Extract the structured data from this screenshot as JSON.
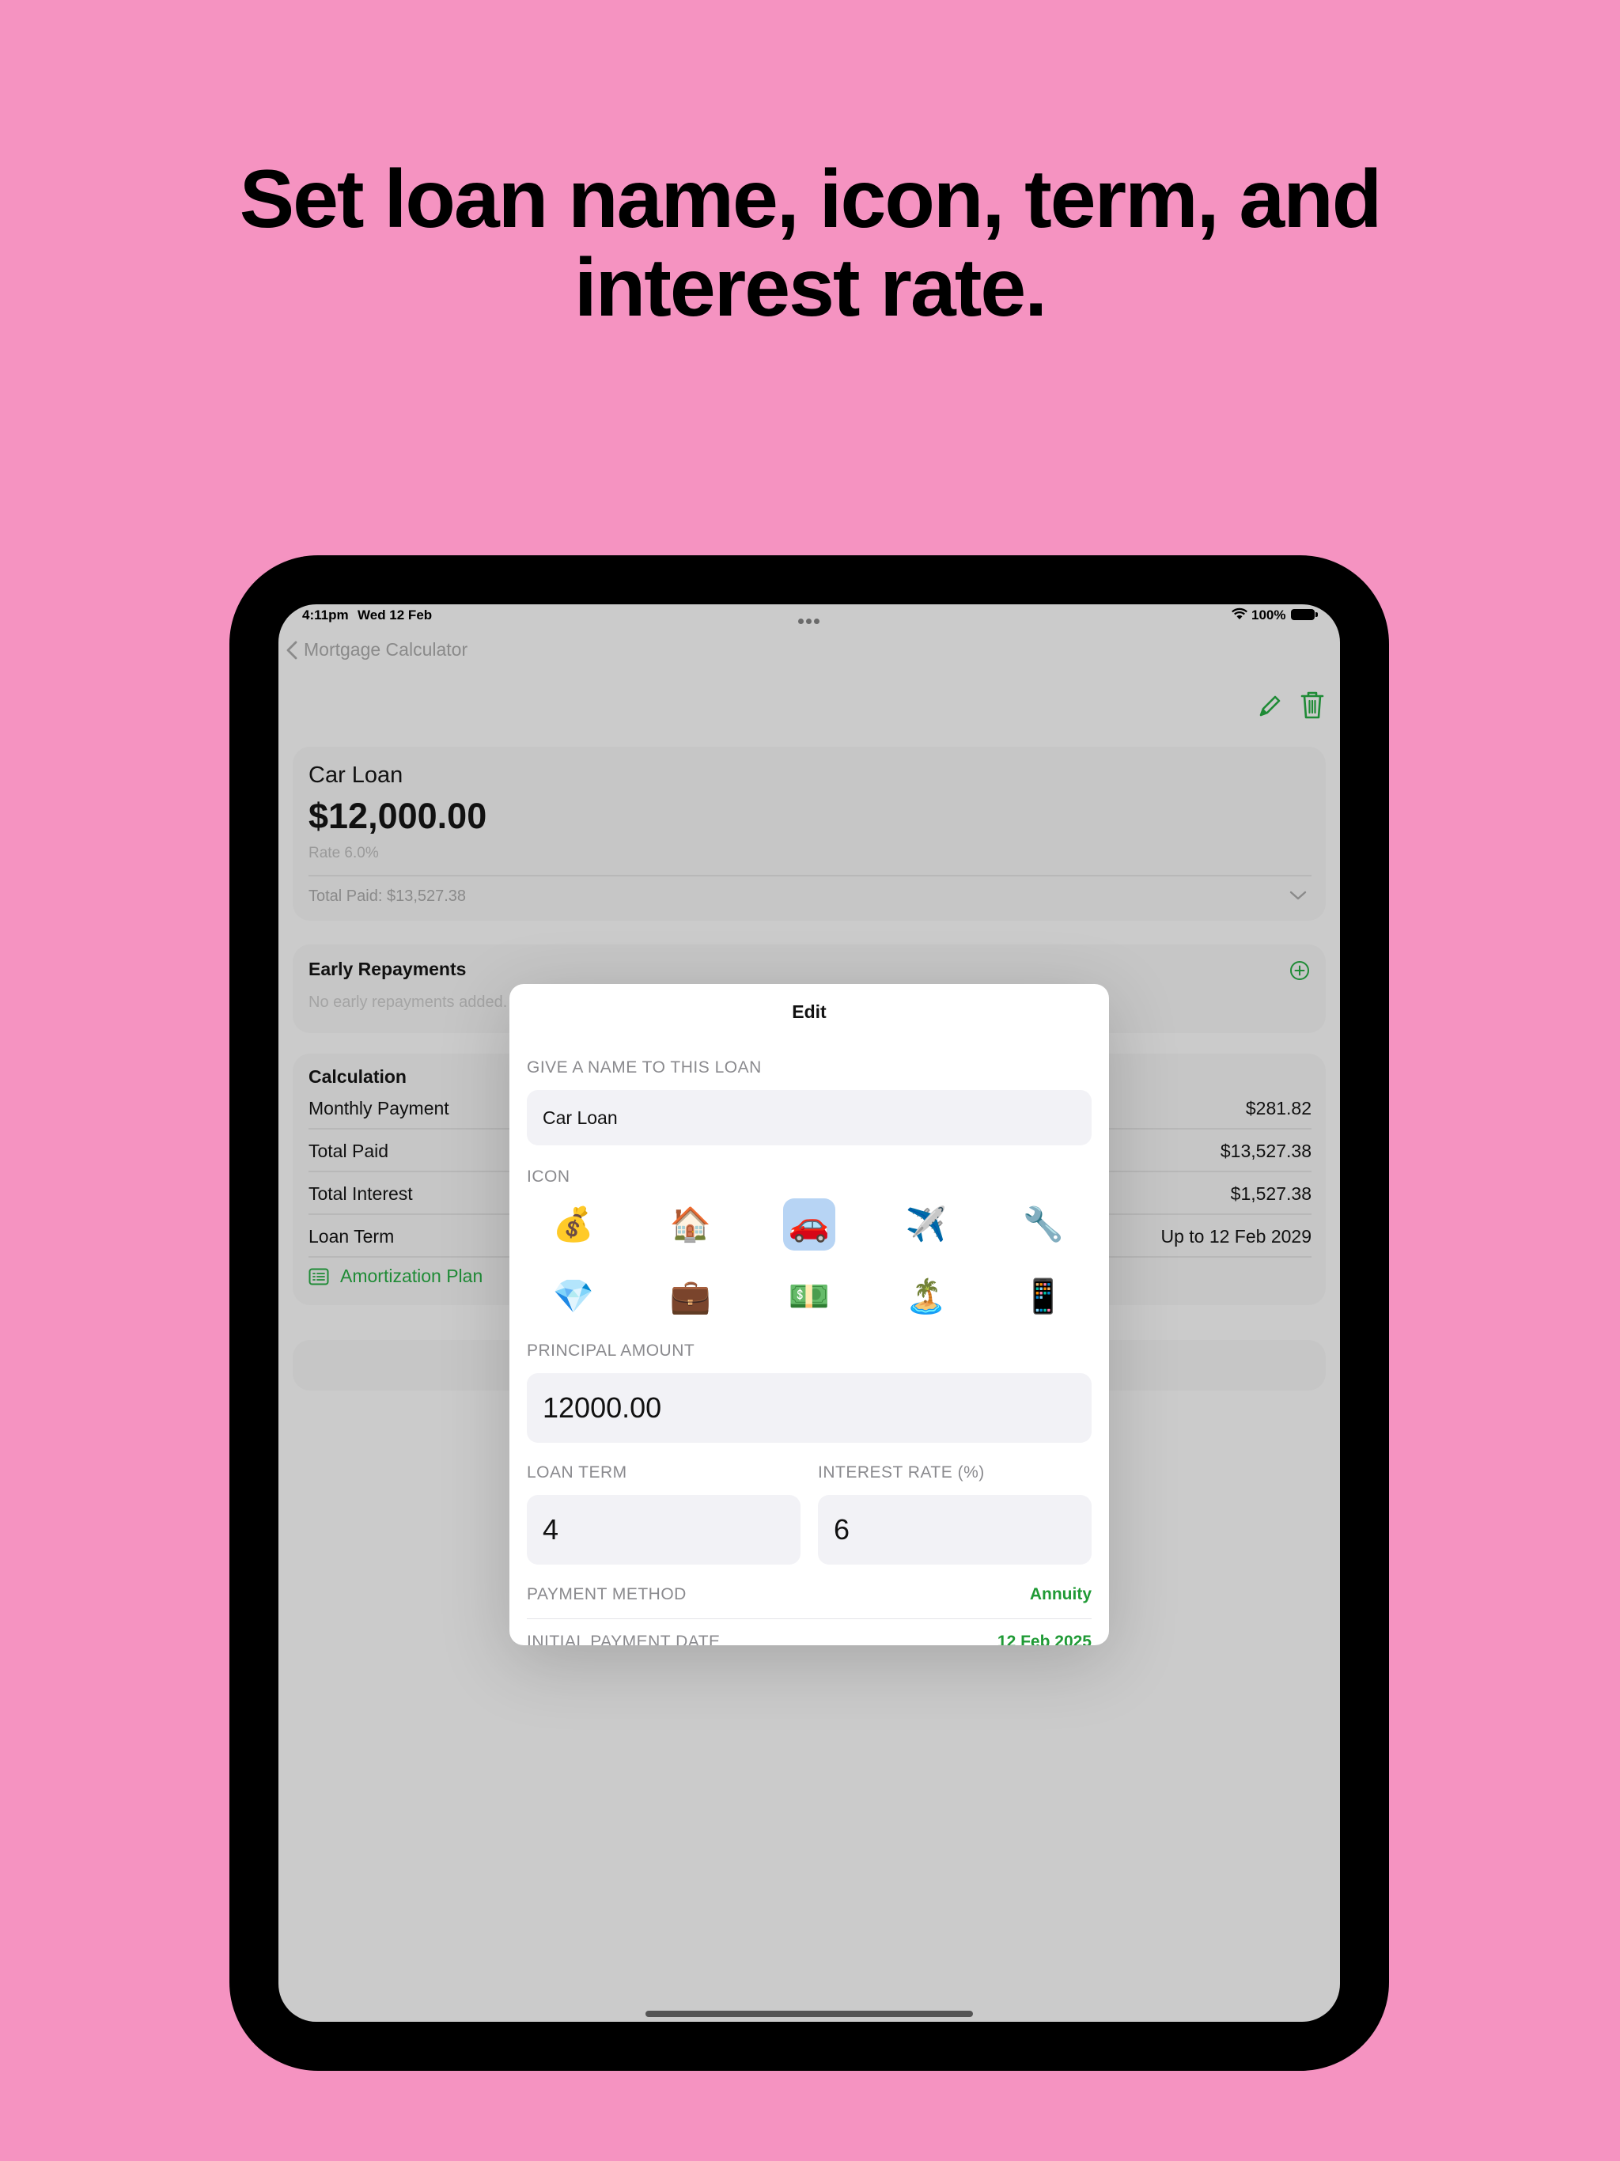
{
  "headline": {
    "line1": "Set loan name, icon, term, and",
    "line2": "interest rate."
  },
  "status_bar": {
    "time": "4:11pm",
    "date": "Wed 12 Feb",
    "battery": "100%"
  },
  "nav": {
    "back_label": "Mortgage Calculator"
  },
  "loan_card": {
    "name": "Car Loan",
    "amount": "$12,000.00",
    "rate": "Rate 6.0%",
    "total_paid": "Total Paid: $13,527.38"
  },
  "early_repayments": {
    "title": "Early Repayments",
    "empty_text": "No early repayments added."
  },
  "calculation": {
    "title": "Calculation",
    "rows": [
      {
        "label": "Monthly Payment",
        "value": "$281.82"
      },
      {
        "label": "Total Paid",
        "value": "$13,527.38"
      },
      {
        "label": "Total Interest",
        "value": "$1,527.38"
      },
      {
        "label": "Loan Term",
        "value": "Up to 12 Feb 2029"
      }
    ],
    "amortization_label": "Amortization Plan"
  },
  "modal": {
    "title": "Edit",
    "name_label": "GIVE A NAME TO THIS LOAN",
    "name_value": "Car Loan",
    "icon_label": "ICON",
    "icons": [
      {
        "glyph": "💰",
        "name": "money-bag-icon",
        "selected": false
      },
      {
        "glyph": "🏠",
        "name": "house-icon",
        "selected": false
      },
      {
        "glyph": "🚗",
        "name": "car-icon",
        "selected": true
      },
      {
        "glyph": "✈️",
        "name": "airplane-icon",
        "selected": false
      },
      {
        "glyph": "🔧",
        "name": "wrench-icon",
        "selected": false
      },
      {
        "glyph": "💎",
        "name": "diamond-icon",
        "selected": false
      },
      {
        "glyph": "💼",
        "name": "briefcase-icon",
        "selected": false
      },
      {
        "glyph": "💵",
        "name": "banknote-icon",
        "selected": false
      },
      {
        "glyph": "🏝️",
        "name": "island-icon",
        "selected": false
      },
      {
        "glyph": "📱",
        "name": "phone-icon",
        "selected": false
      }
    ],
    "principal_label": "PRINCIPAL AMOUNT",
    "principal_value": "12000.00",
    "term_label": "LOAN TERM",
    "term_value": "4",
    "rate_label": "INTEREST RATE (%)",
    "rate_value": "6",
    "payment_method_label": "PAYMENT METHOD",
    "payment_method_value": "Annuity",
    "initial_date_label": "INITIAL PAYMENT DATE",
    "initial_date_value": "12 Feb 2025"
  },
  "colors": {
    "background": "#f593c1",
    "accent_green": "#1f9a35",
    "selected_icon_bg": "#b7d4f4",
    "overlay": "#cbcbcb"
  }
}
